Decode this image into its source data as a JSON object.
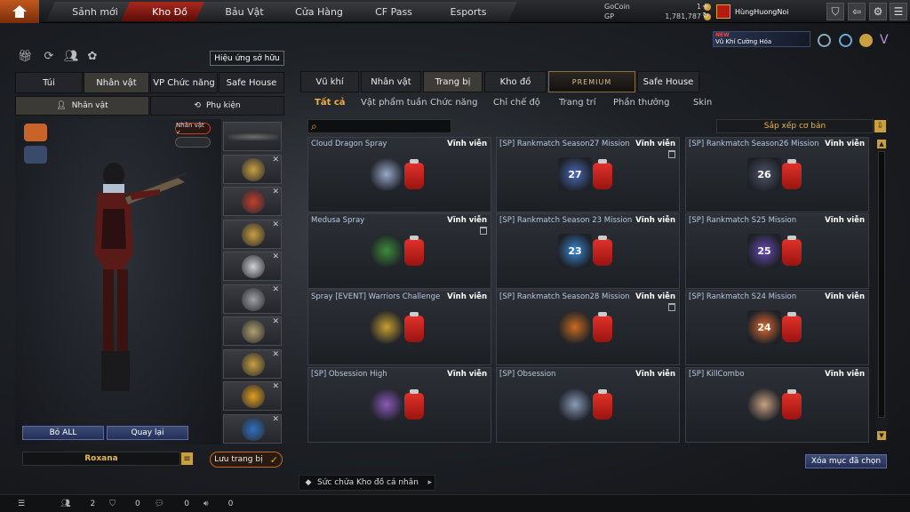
{
  "topnav": {
    "tabs": [
      "Sảnh mới",
      "Kho Đồ",
      "Bảu Vật",
      "Cửa Hàng",
      "CF Pass",
      "Esports"
    ],
    "active": "Kho Đồ"
  },
  "currency": {
    "gocoin_label": "GoCoin",
    "gocoin_value": "1",
    "gp_label": "GP",
    "gp_value": "1,781,787"
  },
  "user": {
    "name": "HùngHuongNoi"
  },
  "promo": {
    "badge": "NEW",
    "text": "Vũ Khí Cường Hóa"
  },
  "left": {
    "effect_button": "Hiệu ứng sở hữu",
    "tabs": [
      "Túi",
      "Nhân vật",
      "VP Chức năng",
      "Safe House"
    ],
    "active_tab": "Nhân vật",
    "sub_tabs": [
      "Nhân vật",
      "Phụ kiện"
    ],
    "toggle_label": "Nhân vật ✓",
    "buttons": {
      "remove_all": "Bỏ ALL",
      "back": "Quay lại"
    },
    "character_name": "Roxana",
    "save_button": "Lưu trang bị"
  },
  "right": {
    "tabs": [
      "Vũ khí",
      "Nhân vật",
      "Trang bị",
      "Kho đồ",
      "PREMIUM",
      "Safe House"
    ],
    "active_tab": "Trang bị",
    "filters": [
      "Tất cả",
      "Vật phẩm tuần",
      "Chức năng",
      "Chỉ chế độ",
      "Trang trí",
      "Phần thưởng",
      "Skin"
    ],
    "active_filter": "Tất cả",
    "sort_label": "Sắp xếp cơ bản",
    "items": [
      {
        "name": "Cloud Dragon Spray",
        "duration": "Vĩnh viễn",
        "emblem": "",
        "color": "#9aa8c8",
        "trash": false
      },
      {
        "name": "[SP] Rankmatch Season27 Mission",
        "duration": "Vĩnh viễn",
        "emblem": "27",
        "color": "#4a6ab8",
        "trash": true
      },
      {
        "name": "[SP] Rankmatch Season26 Mission",
        "duration": "Vĩnh viễn",
        "emblem": "26",
        "color": "#505466",
        "trash": false
      },
      {
        "name": "Medusa Spray",
        "duration": "Vĩnh viễn",
        "emblem": "",
        "color": "#3e8a3a",
        "trash": true
      },
      {
        "name": "[SP] Rankmatch Season 23 Mission",
        "duration": "Vĩnh viễn",
        "emblem": "23",
        "color": "#3a8ad8",
        "trash": false
      },
      {
        "name": "[SP] Rankmatch S25 Mission",
        "duration": "Vĩnh viễn",
        "emblem": "25",
        "color": "#6a4ab8",
        "trash": false
      },
      {
        "name": "Spray [EVENT] Warriors Challenge",
        "duration": "Vĩnh viễn",
        "emblem": "",
        "color": "#c8a030",
        "trash": false
      },
      {
        "name": "[SP] Rankmatch Season28 Mission",
        "duration": "Vĩnh viễn",
        "emblem": "",
        "color": "#c86a20",
        "trash": true
      },
      {
        "name": "[SP] Rankmatch S24 Mission",
        "duration": "Vĩnh viễn",
        "emblem": "24",
        "color": "#e06a30",
        "trash": false
      },
      {
        "name": "[SP] Obsession High",
        "duration": "Vĩnh viễn",
        "emblem": "",
        "color": "#8a5ab8",
        "trash": false
      },
      {
        "name": "[SP] Obsession",
        "duration": "Vĩnh viễn",
        "emblem": "",
        "color": "#8a9ab8",
        "trash": false
      },
      {
        "name": "[SP] KillCombo",
        "duration": "Vĩnh viễn",
        "emblem": "",
        "color": "#c8a080",
        "trash": false
      }
    ],
    "delete_button": "Xóa mục đã chọn",
    "capacity_label": "Sức chứa Kho đồ cá nhân"
  },
  "bottom": {
    "counts": [
      "2",
      "0",
      "0",
      "0"
    ]
  }
}
